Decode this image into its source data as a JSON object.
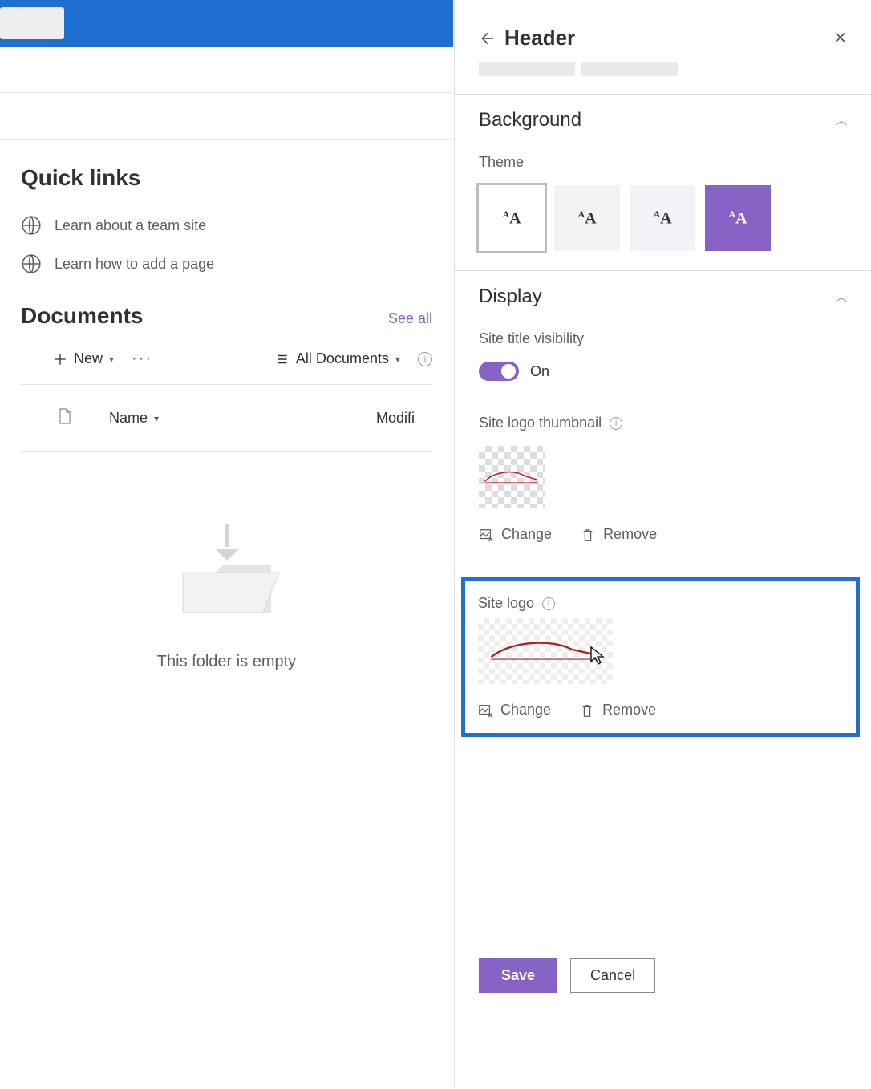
{
  "quick_links": {
    "title": "Quick links",
    "items": [
      {
        "label": "Learn about a team site"
      },
      {
        "label": "Learn how to add a page"
      }
    ]
  },
  "documents": {
    "title": "Documents",
    "see_all": "See all",
    "new_label": "New",
    "all_docs_label": "All Documents",
    "col_name": "Name",
    "col_modified": "Modifi",
    "empty_text": "This folder is empty"
  },
  "panel": {
    "title": "Header",
    "background": {
      "title": "Background",
      "theme_label": "Theme"
    },
    "display": {
      "title": "Display",
      "site_title_vis": "Site title visibility",
      "toggle_state": "On",
      "site_logo_thumb": "Site logo thumbnail",
      "site_logo": "Site logo",
      "change": "Change",
      "remove": "Remove"
    },
    "save": "Save",
    "cancel": "Cancel"
  }
}
